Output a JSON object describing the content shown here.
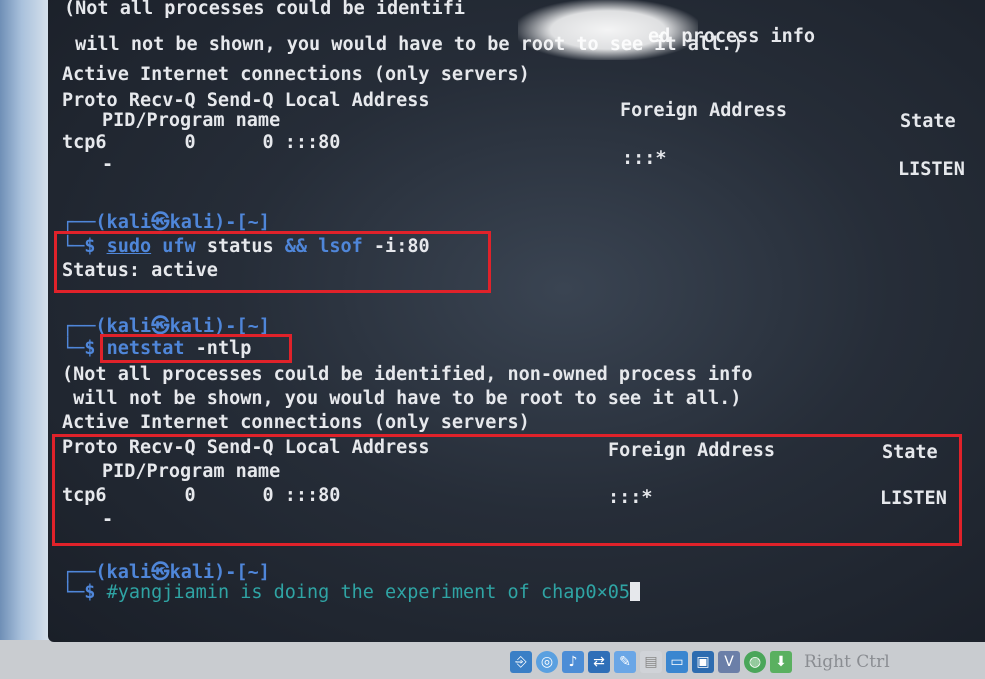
{
  "block1": {
    "warn1": "(Not all processes could be identifi",
    "warn1b": "ed process info",
    "warn2": " will not be shown, you would have to be root to see it all.)",
    "active": "Active Internet connections (only servers)",
    "h_proto": "Proto Recv-Q Send-Q Local Address",
    "h_foreign": "Foreign Address",
    "h_state": "State",
    "h_pid": "PID/Program name",
    "row_proto": "tcp6       0      0 :::80",
    "row_foreign": ":::*",
    "row_state": "LISTEN",
    "row_pid": "-"
  },
  "prompt1": {
    "top": "┌──(kali㉿kali)-[~]",
    "arrow": "└─$ ",
    "sudo": "sudo",
    "ufw": "ufw",
    "status_arg": " status ",
    "and": "&&",
    "lsof": "lsof",
    "lsof_arg": " -i:80",
    "output": "Status: active"
  },
  "prompt2": {
    "top": "┌──(kali㉿kali)-[~]",
    "arrow": "└─$ ",
    "cmd": "netstat",
    "arg": " -ntlp"
  },
  "block2": {
    "warn1": "(Not all processes could be identified, non-owned process info",
    "warn2": " will not be shown, you would have to be root to see it all.)",
    "active": "Active Internet connections (only servers)",
    "h_proto": "Proto Recv-Q Send-Q Local Address",
    "h_foreign": "Foreign Address",
    "h_state": "State",
    "h_pid": "PID/Program name",
    "row_proto": "tcp6       0      0 :::80",
    "row_foreign": ":::*",
    "row_state": "LISTEN",
    "row_pid": "-"
  },
  "prompt3": {
    "top": "┌──(kali㉿kali)-[~]",
    "arrow": "└─$ ",
    "comment": "#yangjiamin is doing the experiment of chap0×05"
  },
  "taskbar": {
    "icons": [
      "usb-icon",
      "cd-icon",
      "audio-icon",
      "network-icon",
      "pen-icon",
      "shared-folder-icon",
      "display-icon",
      "screen-icon",
      "vm-icon",
      "globe-icon",
      "arrow-icon"
    ],
    "host_key": "Right Ctrl"
  },
  "colors": {
    "highlight": "#e0222a",
    "prompt": "#4f86d9",
    "comment": "#2fa4a4",
    "text": "#e6e8ec"
  }
}
